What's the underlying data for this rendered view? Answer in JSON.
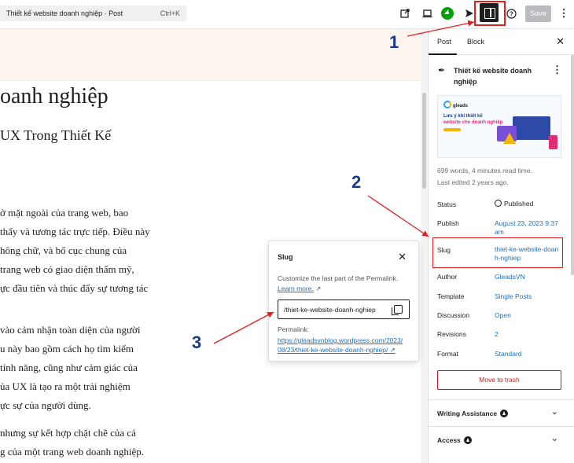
{
  "topbar": {
    "doc_title": "Thiết kế website doanh nghiệp · Post",
    "shortcut": "Ctrl+K",
    "save_label": "Save",
    "icons": [
      "external-link-icon",
      "preview-desktop-icon",
      "jetpack-icon",
      "publish-send-icon",
      "sidebar-toggle-icon",
      "help-icon",
      "more-vertical-icon"
    ]
  },
  "content": {
    "h1": "oanh nghiệp",
    "h2": "UX Trong Thiết Kế",
    "para1": [
      "ở mặt ngoài của trang web, bao",
      "thấy và tương tác trực tiếp. Điều này",
      "hông chữ, và bố cục chung của",
      "trang web có giao diện thẩm mỹ,",
      "ực đầu tiên và thúc đẩy sự tương tác"
    ],
    "para2": [
      "vào cảm nhận toàn diện của người",
      "u này bao gồm cách họ tìm kiếm",
      "tính năng, cũng như cảm giác của",
      "ủa UX là tạo ra một trải nghiệm",
      "ực sự của người dùng."
    ],
    "para3": [
      "nhưng sự kết hợp chặt chẽ của cả",
      "g của một trang web doanh nghiệp."
    ]
  },
  "popover": {
    "title": "Slug",
    "description": "Customize the last part of the Permalink.",
    "learn_more": "Learn more.",
    "slug_value": "/thiet-ke-website-doanh-nghiep",
    "permalink_label": "Permalink:",
    "permalink_line1": "https://gleadsvnblog.wordpress.com/2023/",
    "permalink_line2": "08/23/thiet-ke-website-doanh-nghiep/"
  },
  "sidebar": {
    "tab_post": "Post",
    "tab_block": "Block",
    "post_title": "Thiết kế website doanh nghiệp",
    "featured_image": {
      "brand": "gleads",
      "line1": "Lưu ý khi thiết kế",
      "line2": "website cho doanh nghiệp"
    },
    "word_count": "699 words, 4 minutes read time.",
    "last_edited": "Last edited 2 years ago.",
    "rows": [
      {
        "label": "Status",
        "value": "Published"
      },
      {
        "label": "Publish",
        "value": "August 23, 2023 9:37 am"
      },
      {
        "label": "Slug",
        "value": "thiet-ke-website-doanh-nghiep"
      },
      {
        "label": "Author",
        "value": "GleadsVN"
      },
      {
        "label": "Template",
        "value": "Single Posts"
      },
      {
        "label": "Discussion",
        "value": "Open"
      },
      {
        "label": "Revisions",
        "value": "2"
      },
      {
        "label": "Format",
        "value": "Standard"
      }
    ],
    "trash_label": "Move to trash",
    "panel_writing": "Writing Assistance",
    "panel_access": "Access"
  },
  "annotations": {
    "n1": "1",
    "n2": "2",
    "n3": "3",
    "color": "#e02020"
  }
}
